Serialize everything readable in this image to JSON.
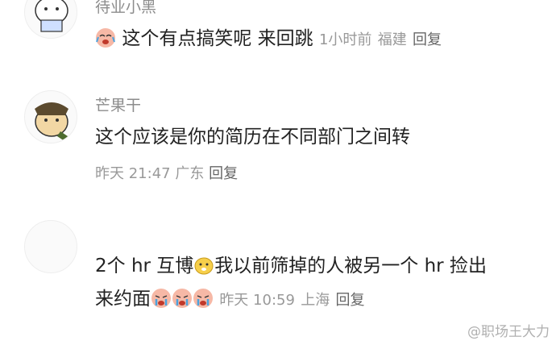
{
  "comments": [
    {
      "username": "待业小黑",
      "text": "这个有点搞笑呢 来回跳",
      "time": "1小时前",
      "location": "福建",
      "reply_label": "回复"
    },
    {
      "username": "芒果干",
      "text": "这个应该是你的简历在不同部门之间转",
      "time": "昨天 21:47",
      "location": "广东",
      "reply_label": "回复"
    },
    {
      "username": "",
      "text_part1": "2个 hr 互博",
      "text_part2": "我以前筛掉的人被另一个 hr 捡出",
      "text_part3": "来约面",
      "time": "昨天 10:59",
      "location": "上海",
      "reply_label": "回复"
    }
  ],
  "watermark": "@职场王大力",
  "colors": {
    "meta": "#999999",
    "name": "#8c8c8c",
    "text": "#222222",
    "emoji_face": "#f6b8a6"
  }
}
